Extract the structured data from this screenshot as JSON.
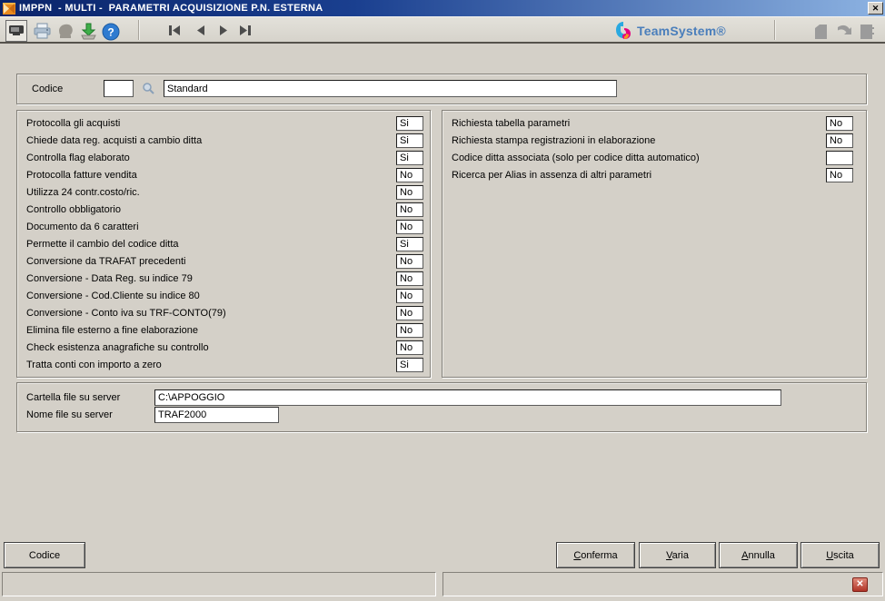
{
  "window": {
    "title": "IMPPN  - MULTI -  PARAMETRI ACQUISIZIONE P.N. ESTERNA"
  },
  "icons": {
    "close": "✕",
    "help": "?",
    "status_error": "✕"
  },
  "brand": {
    "name": "TeamSystem®"
  },
  "colors": {
    "titlebar_start": "#0a246a",
    "titlebar_end": "#8db3e2",
    "window_bg": "#d4d0c8",
    "brand_blue": "#4a7ebb",
    "help_blue": "#2f7bd0",
    "error_red": "#b03428"
  },
  "codice": {
    "label": "Codice",
    "code_value": "",
    "description_value": "Standard"
  },
  "left_params": [
    {
      "label": "Protocolla gli acquisti",
      "value": "Si"
    },
    {
      "label": "Chiede data reg. acquisti a cambio ditta",
      "value": "Si"
    },
    {
      "label": "Controlla flag elaborato",
      "value": "Si"
    },
    {
      "label": "Protocolla fatture vendita",
      "value": "No"
    },
    {
      "label": "Utilizza 24 contr.costo/ric.",
      "value": "No"
    },
    {
      "label": "Controllo obbligatorio",
      "value": "No"
    },
    {
      "label": "Documento da 6 caratteri",
      "value": "No"
    },
    {
      "label": "Permette il cambio del codice ditta",
      "value": "Si"
    },
    {
      "label": "Conversione da TRAFAT precedenti",
      "value": "No"
    },
    {
      "label": "Conversione - Data Reg. su indice 79",
      "value": "No"
    },
    {
      "label": "Conversione - Cod.Cliente su indice 80",
      "value": "No"
    },
    {
      "label": "Conversione - Conto iva su TRF-CONTO(79)",
      "value": "No"
    },
    {
      "label": "Elimina file esterno a fine elaborazione",
      "value": "No"
    },
    {
      "label": "Check esistenza anagrafiche su controllo",
      "value": "No"
    },
    {
      "label": "Tratta conti con importo a zero",
      "value": "Si"
    }
  ],
  "right_params": [
    {
      "label": "Richiesta tabella parametri",
      "value": "No"
    },
    {
      "label": "Richiesta stampa registrazioni in elaborazione",
      "value": "No"
    },
    {
      "label": "Codice ditta associata (solo per codice ditta automatico)",
      "value": ""
    },
    {
      "label": "Ricerca per Alias in assenza di altri parametri",
      "value": "No"
    }
  ],
  "server": {
    "folder_label": "Cartella file su server",
    "folder_value": "C:\\APPOGGIO",
    "file_label": "Nome file su server",
    "file_value": "TRAF2000"
  },
  "buttons": {
    "codice": "Codice",
    "conferma": "Conferma",
    "varia": "Varia",
    "annulla": "Annulla",
    "uscita": "Uscita"
  }
}
